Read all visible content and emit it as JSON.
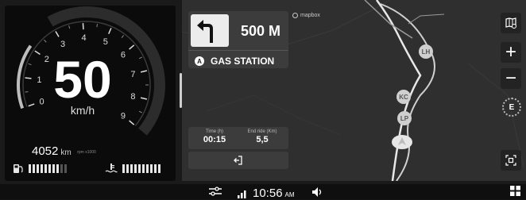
{
  "dashboard": {
    "speed": "50",
    "speed_unit": "km/h",
    "odometer": "4052",
    "odometer_unit": "km",
    "gauge_numbers": [
      "0",
      "1",
      "2",
      "3",
      "4",
      "5",
      "6",
      "7",
      "8",
      "9"
    ],
    "gauge_sublabel": "rpm x1000",
    "fuel_level_bars": 8,
    "fuel_total_bars": 10,
    "temp_level_bars": 10,
    "temp_total_bars": 10,
    "fuel_icon": "fuel-pump-icon",
    "temp_icon": "coolant-temperature-icon"
  },
  "navigation": {
    "maneuver_icon": "turn-left-icon",
    "distance": "500 M",
    "destination_marker": "A",
    "destination": "GAS STATION",
    "attribution": "mapbox",
    "trip": {
      "time_label": "Time (h)",
      "time_value": "00:15",
      "distance_label": "End ride (Km)",
      "distance_value": "5,5"
    },
    "exit_icon": "exit-route-icon"
  },
  "map": {
    "pois": [
      "LH",
      "KC",
      "LP"
    ],
    "controls": {
      "map_layers_icon": "map-settings-icon",
      "zoom_in_label": "+",
      "zoom_out_label": "−",
      "compass_label": "E",
      "recenter_icon": "recenter-icon"
    }
  },
  "status_bar": {
    "settings_icon": "sliders-icon",
    "signal_icon": "signal-bars-icon",
    "time": "10:56",
    "ampm": "AM",
    "volume_icon": "speaker-icon",
    "apps_icon": "grid-icon"
  }
}
